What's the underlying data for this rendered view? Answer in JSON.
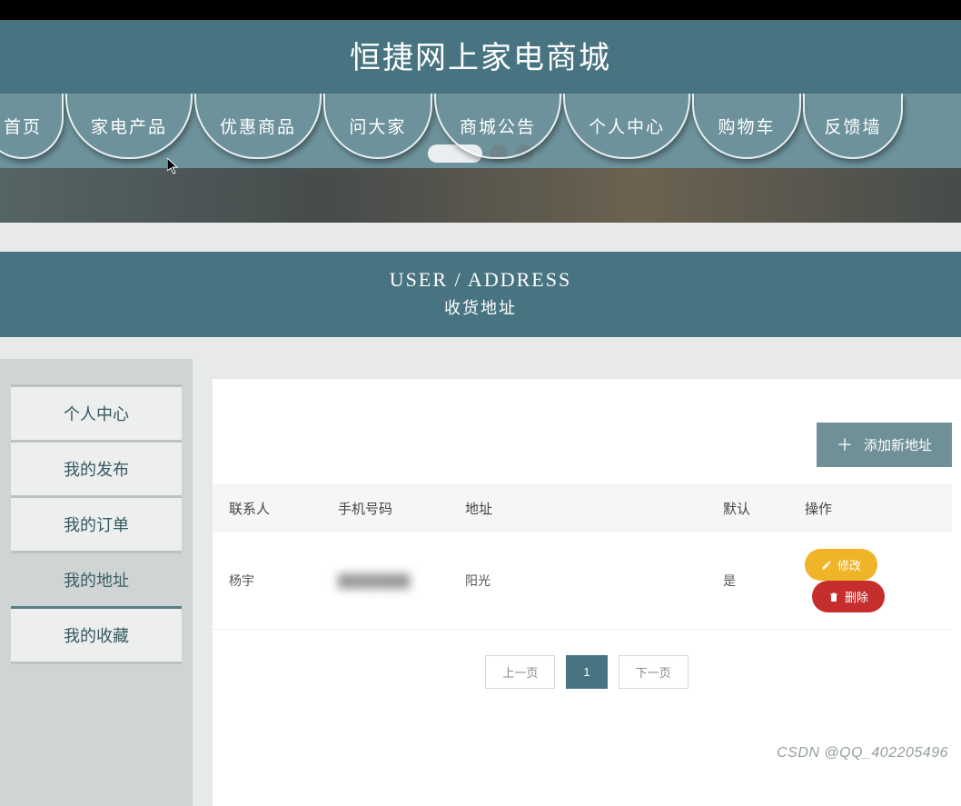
{
  "header": {
    "site_title": "恒捷网上家电商城"
  },
  "nav": {
    "items": [
      "首页",
      "家电产品",
      "优惠商品",
      "问大家",
      "商城公告",
      "个人中心",
      "购物车",
      "反馈墙"
    ]
  },
  "carousel": {
    "active_index": 0,
    "total": 3
  },
  "page_title": {
    "en": "USER / ADDRESS",
    "cn": "收货地址"
  },
  "sidebar": {
    "items": [
      {
        "label": "个人中心",
        "active": false
      },
      {
        "label": "我的发布",
        "active": false
      },
      {
        "label": "我的订单",
        "active": false
      },
      {
        "label": "我的地址",
        "active": true
      },
      {
        "label": "我的收藏",
        "active": false
      }
    ]
  },
  "address_panel": {
    "add_button_label": "添加新地址",
    "columns": {
      "contact": "联系人",
      "phone": "手机号码",
      "address": "地址",
      "default": "默认",
      "ops": "操作"
    },
    "rows": [
      {
        "contact": "杨宇",
        "phone": "████████",
        "address": "阳光",
        "is_default": "是"
      }
    ],
    "ops": {
      "edit": "修改",
      "delete": "删除"
    }
  },
  "pager": {
    "prev": "上一页",
    "next": "下一页",
    "current": "1"
  },
  "watermark": "CSDN @QQ_402205496"
}
